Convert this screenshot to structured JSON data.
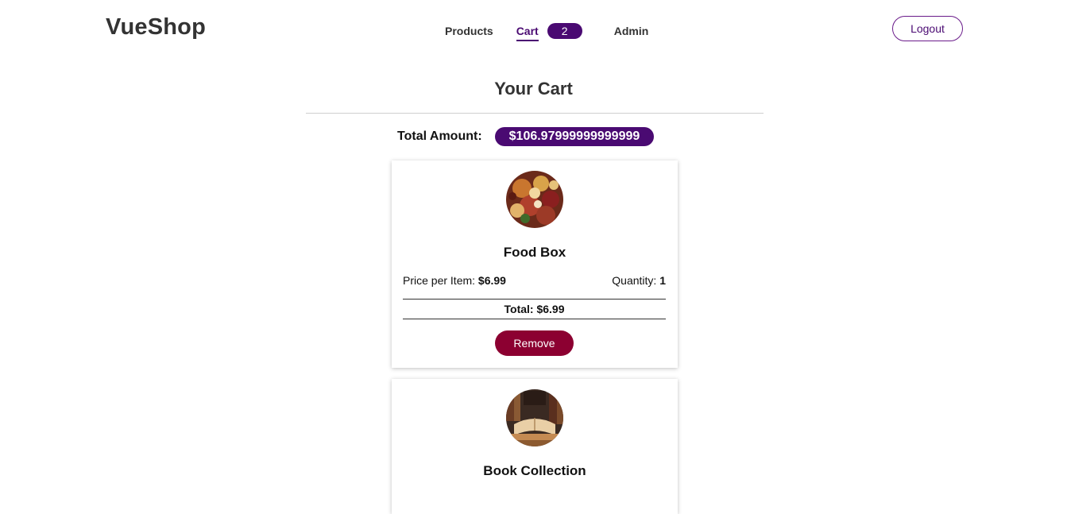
{
  "header": {
    "brand": "VueShop",
    "nav": {
      "products": "Products",
      "cart": "Cart",
      "cart_count": "2",
      "admin": "Admin"
    },
    "logout": "Logout"
  },
  "page": {
    "title": "Your Cart",
    "total_label": "Total Amount:",
    "total_value": "$106.97999999999999"
  },
  "cart_items": [
    {
      "name": "Food Box",
      "price_label": "Price per Item:",
      "price": "$6.99",
      "quantity_label": "Quantity:",
      "quantity": "1",
      "total_text": "Total: $6.99",
      "remove_label": "Remove",
      "image_icon": "food-image"
    },
    {
      "name": "Book Collection",
      "image_icon": "books-image"
    }
  ],
  "colors": {
    "accent": "#4a0a72",
    "remove": "#8c0031"
  }
}
